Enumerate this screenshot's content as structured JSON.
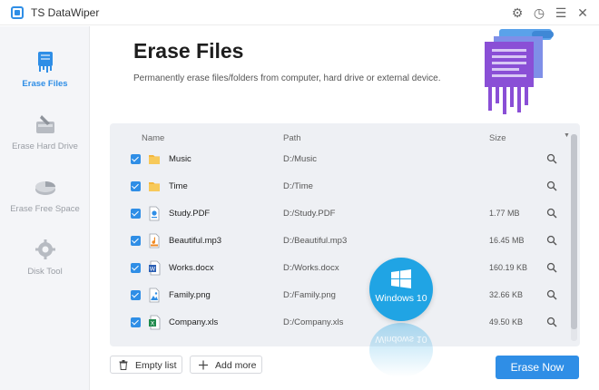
{
  "app": {
    "title": "TS DataWiper"
  },
  "window_controls": [
    {
      "name": "settings-icon",
      "glyph": "⚙"
    },
    {
      "name": "history-icon",
      "glyph": "◷"
    },
    {
      "name": "menu-icon",
      "glyph": "☰"
    },
    {
      "name": "close-icon",
      "glyph": "✕"
    }
  ],
  "sidebar": {
    "items": [
      {
        "label": "Erase Files",
        "icon": "erase-files-icon",
        "active": true
      },
      {
        "label": "Erase Hard Drive",
        "icon": "erase-drive-icon",
        "active": false
      },
      {
        "label": "Erase Free Space",
        "icon": "erase-free-space-icon",
        "active": false
      },
      {
        "label": "Disk Tool",
        "icon": "disk-tool-icon",
        "active": false
      }
    ]
  },
  "main": {
    "title": "Erase Files",
    "subtitle": "Permanently erase files/folders from computer, hard drive or external device."
  },
  "file_list": {
    "columns": {
      "name": "Name",
      "path": "Path",
      "size": "Size"
    },
    "rows": [
      {
        "name": "Music",
        "path": "D:/Music",
        "size": "",
        "type": "folder",
        "checked": true
      },
      {
        "name": "Time",
        "path": "D:/Time",
        "size": "",
        "type": "folder",
        "checked": true
      },
      {
        "name": "Study.PDF",
        "path": "D:/Study.PDF",
        "size": "1.77 MB",
        "type": "pdf",
        "checked": true
      },
      {
        "name": "Beautiful.mp3",
        "path": "D:/Beautiful.mp3",
        "size": "16.45 MB",
        "type": "mp3",
        "checked": true
      },
      {
        "name": "Works.docx",
        "path": "D:/Works.docx",
        "size": "160.19 KB",
        "type": "docx",
        "checked": true
      },
      {
        "name": "Family.png",
        "path": "D:/Family.png",
        "size": "32.66 KB",
        "type": "png",
        "checked": true
      },
      {
        "name": "Company.xls",
        "path": "D:/Company.xls",
        "size": "49.50 KB",
        "type": "xls",
        "checked": true
      }
    ]
  },
  "badge": {
    "text": "Windows 10"
  },
  "buttons": {
    "empty_list": "Empty list",
    "add_more": "Add more",
    "erase_now": "Erase Now"
  },
  "colors": {
    "accent": "#2f8ee6",
    "badge": "#20a4e4",
    "hero": "#8a4fd6"
  }
}
